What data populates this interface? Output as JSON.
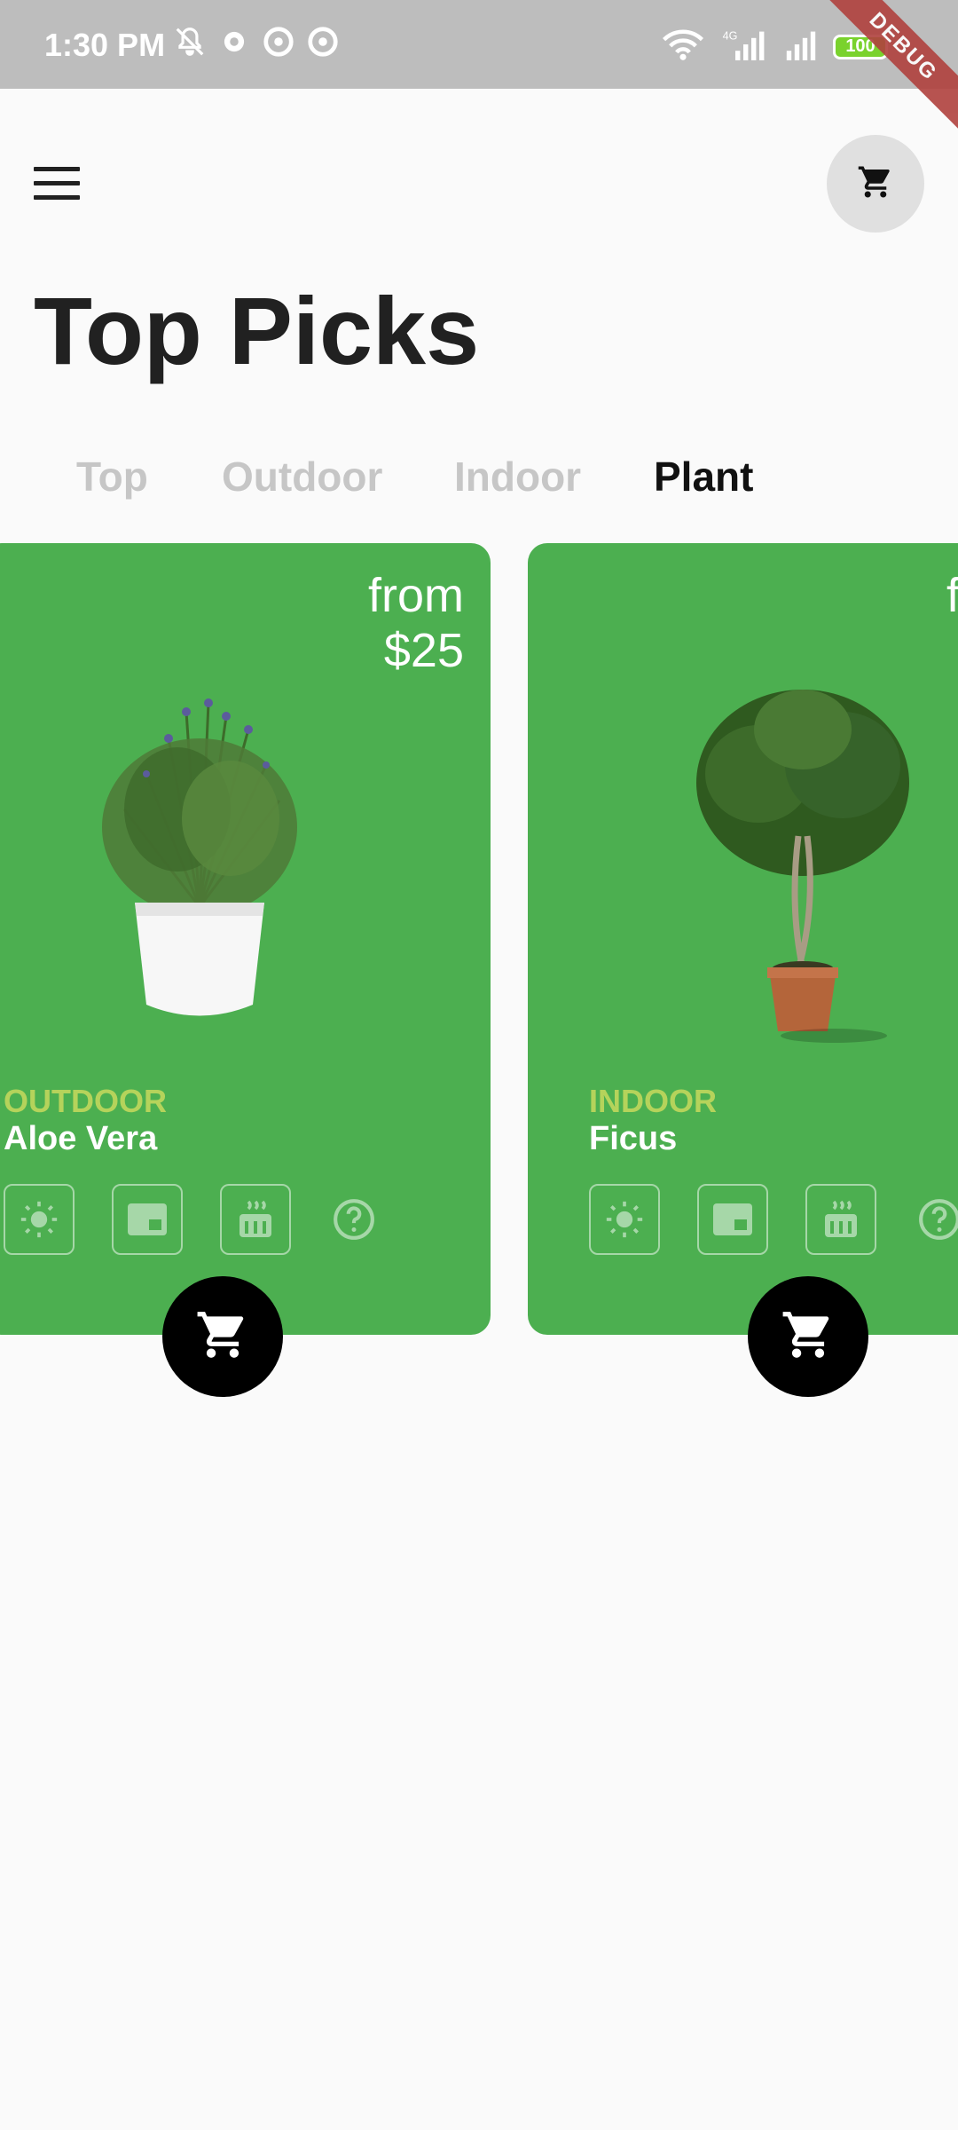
{
  "status_bar": {
    "time": "1:30 PM",
    "battery": "100",
    "network": "4G"
  },
  "debug_banner": "DEBUG",
  "header": {
    "menu_icon": "menu-icon",
    "cart_icon": "shopping-cart-icon"
  },
  "page_title": "Top Picks",
  "tabs": [
    {
      "label": "Top",
      "active": false
    },
    {
      "label": "Outdoor",
      "active": false
    },
    {
      "label": "Indoor",
      "active": false
    },
    {
      "label": "Plant",
      "active": true
    }
  ],
  "products": [
    {
      "price_prefix": "from",
      "price": "$25",
      "category": "OUTDOOR",
      "name": "Aloe Vera",
      "feature_icons": [
        "sun-icon",
        "window-icon",
        "water-heater-icon",
        "help-icon"
      ]
    },
    {
      "price_prefix": "f",
      "price": "",
      "category": "INDOOR",
      "name": "Ficus",
      "feature_icons": [
        "sun-icon",
        "window-icon",
        "water-heater-icon",
        "help-icon"
      ]
    }
  ],
  "colors": {
    "card_green": "#4caf50",
    "category_text": "#b5d35b",
    "fab_black": "#000000",
    "status_bar": "#bdbdbd"
  }
}
